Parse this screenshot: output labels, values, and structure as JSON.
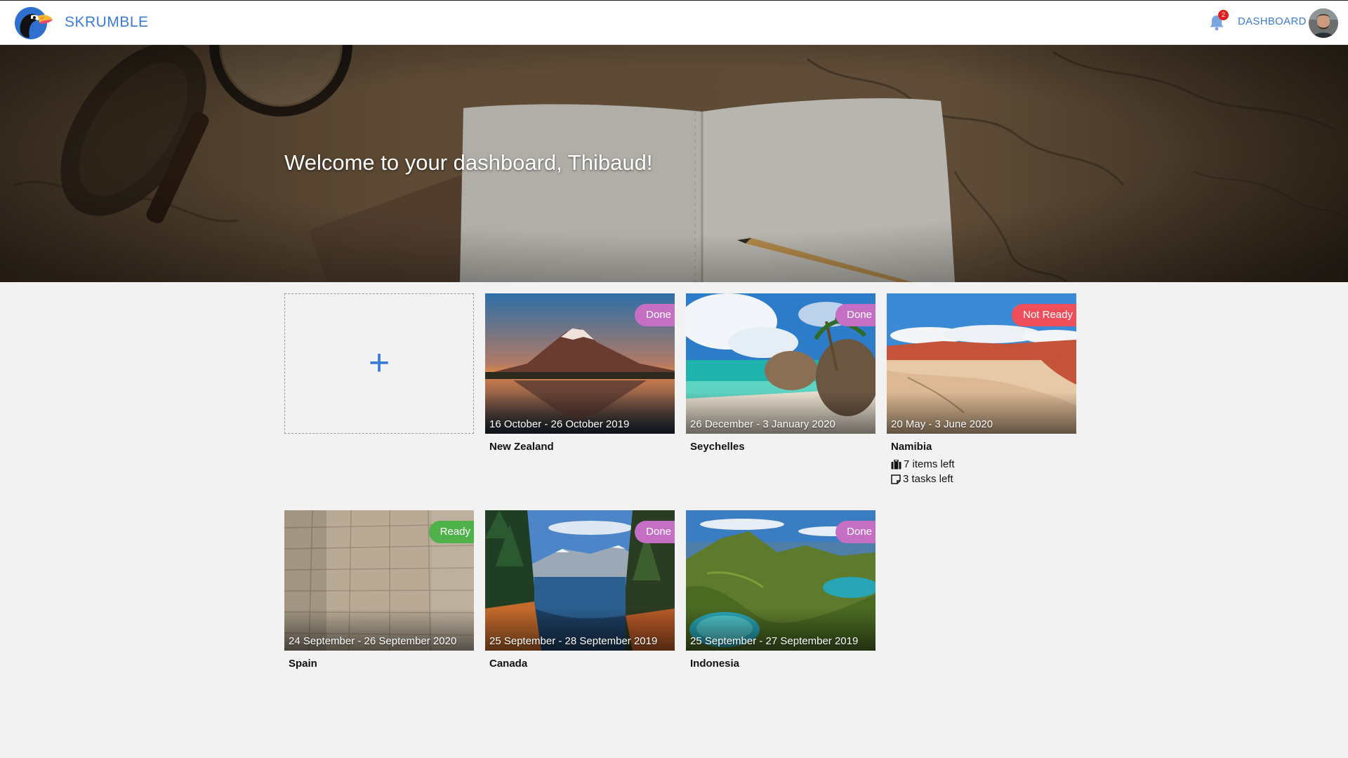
{
  "app": {
    "brand": "SKRUMBLE",
    "nav_dashboard": "DASHBOARD",
    "notification_count": "2",
    "accent_color": "#3a7bd5"
  },
  "hero": {
    "title": "Welcome to your dashboard, Thibaud!"
  },
  "add_trip": {
    "icon": "plus-icon",
    "label": "+"
  },
  "trips": [
    {
      "name": "New Zealand",
      "dates": "16 October - 26 October 2019",
      "status": "Done",
      "status_color": "#c46fc4"
    },
    {
      "name": "Seychelles",
      "dates": "26 December - 3 January 2020",
      "status": "Done",
      "status_color": "#c46fc4"
    },
    {
      "name": "Namibia",
      "dates": "20 May - 3 June 2020",
      "status": "Not Ready",
      "status_color": "#ee4f5b",
      "items_left": "7 items left",
      "tasks_left": "3 tasks left"
    },
    {
      "name": "Spain",
      "dates": "24 September - 26 September 2020",
      "status": "Ready",
      "status_color": "#4fb14a"
    },
    {
      "name": "Canada",
      "dates": "25 September - 28 September 2019",
      "status": "Done",
      "status_color": "#c46fc4"
    },
    {
      "name": "Indonesia",
      "dates": "25 September - 27 September 2019",
      "status": "Done",
      "status_color": "#c46fc4"
    }
  ]
}
